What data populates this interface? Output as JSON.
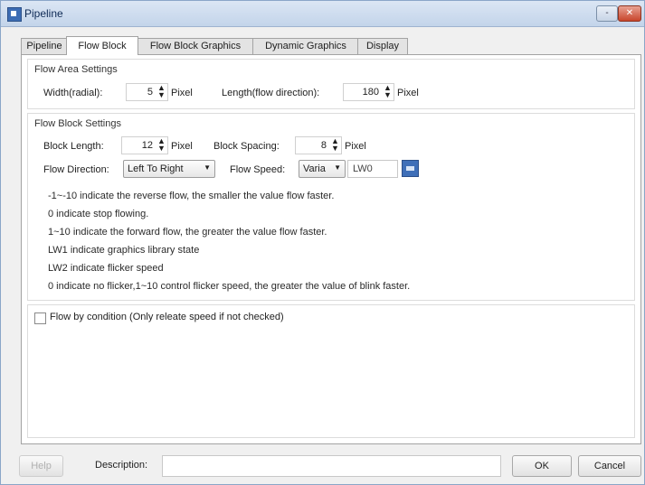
{
  "window": {
    "title": "Pipeline",
    "min_label": "-",
    "close_label": "✕"
  },
  "tabs": [
    "Pipeline",
    "Flow Block",
    "Flow Block Graphics",
    "Dynamic Graphics",
    "Display"
  ],
  "flow_area": {
    "title": "Flow Area Settings",
    "width_label": "Width(radial):",
    "width_value": "5",
    "width_unit": "Pixel",
    "length_label": "Length(flow direction):",
    "length_value": "180",
    "length_unit": "Pixel"
  },
  "flow_block": {
    "title": "Flow Block Settings",
    "block_length_label": "Block Length:",
    "block_length_value": "12",
    "block_length_unit": "Pixel",
    "block_spacing_label": "Block Spacing:",
    "block_spacing_value": "8",
    "block_spacing_unit": "Pixel",
    "direction_label": "Flow Direction:",
    "direction_value": "Left To Right",
    "speed_label": "Flow Speed:",
    "speed_value": "Varia",
    "speed_address": "LW0"
  },
  "notes": [
    "-1~-10 indicate the reverse flow, the smaller the value flow faster.",
    "0 indicate stop flowing.",
    "1~10  indicate the forward flow, the greater the value flow faster.",
    "LW1 indicate graphics library state",
    "LW2 indicate flicker speed",
    "0  indicate no flicker,1~10  control  flicker  speed, the greater the value of blink faster."
  ],
  "condition": {
    "label": "Flow by condition (Only releate speed if not checked)",
    "checked": false
  },
  "footer": {
    "help_label": "Help",
    "description_label": "Description:",
    "description_value": "",
    "ok_label": "OK",
    "cancel_label": "Cancel"
  }
}
